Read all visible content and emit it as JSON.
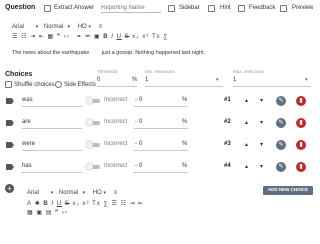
{
  "question": {
    "title": "Question",
    "extract_answer_label": "Extract Answer",
    "reporting_name_placeholder": "Reporting Name",
    "sidebar_label": "Sidebar",
    "hint_label": "Hint",
    "feedback_label": "Feedback",
    "preview_label": "Preview",
    "toolbar": {
      "font": "Arial",
      "size": "Normal",
      "heading": "HO"
    },
    "text": "The news about the earthquake        just a gossip. Nothing happened last night."
  },
  "choices": {
    "title": "Choices",
    "shuffle_label": "Shuffle choices",
    "side_effects_label": "Side Effects",
    "threshold_label": "Threshold",
    "threshold_value": "0",
    "threshold_unit": "%",
    "min_label": "Min. selections",
    "min_value": "1",
    "max_label": "Max. selections",
    "max_value": "1",
    "items": [
      {
        "text": "was",
        "correct_label": "Incorrect",
        "score": "0",
        "unit": "%",
        "index": "#1"
      },
      {
        "text": "are",
        "correct_label": "Incorrect",
        "score": "0",
        "unit": "%",
        "index": "#2"
      },
      {
        "text": "were",
        "correct_label": "Incorrect",
        "score": "0",
        "unit": "%",
        "index": "#3"
      },
      {
        "text": "has",
        "correct_label": "Incorrect",
        "score": "0",
        "unit": "%",
        "index": "#4"
      }
    ],
    "add_button": "ADD NEW CHOICE",
    "toolbar": {
      "font": "Arial",
      "size": "Normal",
      "heading": "HO"
    }
  },
  "colors": {
    "edit": "#5f7184",
    "delete": "#c62828",
    "add_button": "#607080"
  }
}
